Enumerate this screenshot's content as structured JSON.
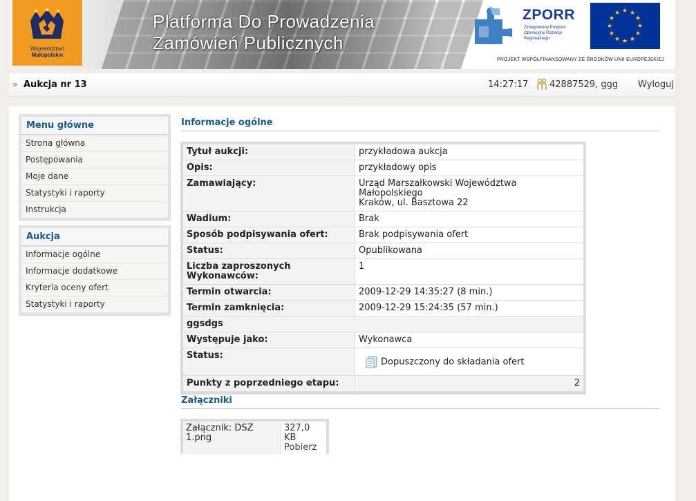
{
  "header": {
    "logo_line1": "Województwo",
    "logo_line2": "Małopolskie",
    "title_line1": "Platforma Do Prowadzenia",
    "title_line2": "Zamówień Publicznych",
    "zporr_name": "ZPORR",
    "zporr_sub": "Zintegrowany Program Operacyjny Rozwoju Regionalnego",
    "cofinanced": "PROJEKT WSPÓŁFINANSOWANY ZE ŚRODKÓW UNII EUROPEJSKIEJ"
  },
  "topbar": {
    "chevron": "»",
    "auction_title": "Aukcja nr 13",
    "clock": "14:27:17",
    "user": "42887529, ggg",
    "logout": "Wyloguj"
  },
  "menu_main": {
    "heading": "Menu główne",
    "items": [
      "Strona główna",
      "Postępowania",
      "Moje dane",
      "Statystyki i raporty",
      "Instrukcja"
    ]
  },
  "menu_auction": {
    "heading": "Aukcja",
    "items": [
      "Informacje ogólne",
      "Informacje dodatkowe",
      "Kryteria oceny ofert",
      "Statystyki i raporty"
    ]
  },
  "info": {
    "section_title": "Informacje ogólne",
    "rows": {
      "title": {
        "label": "Tytuł aukcji:",
        "value": "przykładowa aukcja"
      },
      "desc": {
        "label": "Opis:",
        "value": "przykładowy opis"
      },
      "orderer": {
        "label": "Zamawiający:",
        "value_line1": "Urząd Marszałkowski Województwa Małopolskiego",
        "value_line2": "Kraków, ul. Basztowa 22"
      },
      "wadium": {
        "label": "Wadium:",
        "value": "Brak"
      },
      "signing": {
        "label": "Sposób podpisywania ofert:",
        "value": "Brak podpisywania ofert"
      },
      "status": {
        "label": "Status:",
        "value": "Opublikowana"
      },
      "invited": {
        "label": "Liczba zaproszonych Wykonawców:",
        "value": "1"
      },
      "open": {
        "label": "Termin otwarcia:",
        "value": "2009-12-29 14:35:27 (8 min.)"
      },
      "close": {
        "label": "Termin zamknięcia:",
        "value": "2009-12-29 15:24:35 (57 min.)"
      },
      "group": {
        "label": "ggsdgs"
      },
      "role": {
        "label": "Występuje jako:",
        "value": "Wykonawca"
      },
      "participant_status": {
        "label": "Status:",
        "value": "Dopuszczony do składania ofert"
      },
      "points": {
        "label": "Punkty z poprzedniego etapu:",
        "value": "2"
      }
    }
  },
  "attachments": {
    "section_title": "Załączniki",
    "name": "Załącznik: DSZ 1.png",
    "size": "327,0 KB",
    "download": "Pobierz"
  },
  "colors": {
    "accent": "#1a5b8a",
    "logo_orange": "#f29b20",
    "eu_blue": "#003399",
    "eu_star": "#ffcc00"
  },
  "icons": [
    "crest-icon",
    "puzzle-icon",
    "eu-flag-icon",
    "user-icon",
    "document-icon",
    "chevron-icon"
  ]
}
